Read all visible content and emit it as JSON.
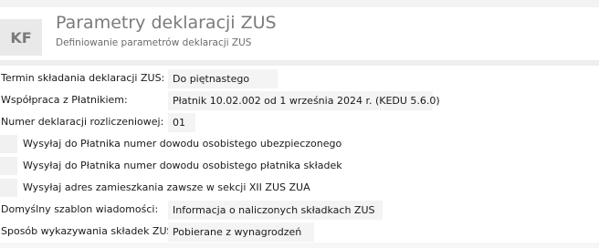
{
  "header": {
    "logo_text": "KF",
    "title": "Parametry deklaracji ZUS",
    "subtitle": "Definiowanie parametrów deklaracji ZUS"
  },
  "form": {
    "termin": {
      "label": "Termin składania deklaracji ZUS:",
      "value": "Do piętnastego"
    },
    "wspolpraca": {
      "label": "Współpraca z Płatnikiem:",
      "value": "Płatnik 10.02.002 od 1 września 2024 r. (KEDU 5.6.0)"
    },
    "numer": {
      "label": "Numer deklaracji rozliczeniowej:",
      "value": "01"
    },
    "checkboxes": [
      {
        "label": "Wysyłaj do Płatnika numer dowodu osobistego ubezpieczonego",
        "checked": false
      },
      {
        "label": "Wysyłaj do Płatnika numer dowodu osobistego płatnika składek",
        "checked": false
      },
      {
        "label": "Wysyłaj adres zamieszkania zawsze w sekcji XII ZUS ZUA",
        "checked": false
      }
    ],
    "szablon": {
      "label": "Domyślny szablon wiadomości:",
      "value": "Informacja o naliczonych składkach ZUS"
    },
    "sposob": {
      "label": "Sposób wykazywania składek ZUS:",
      "value": "Pobierane z wynagrodzeń"
    }
  },
  "colors": {
    "logo_bg": "#e9e9e9",
    "field_bg": "#f4f4f4",
    "title_text": "#7b7b7b"
  }
}
